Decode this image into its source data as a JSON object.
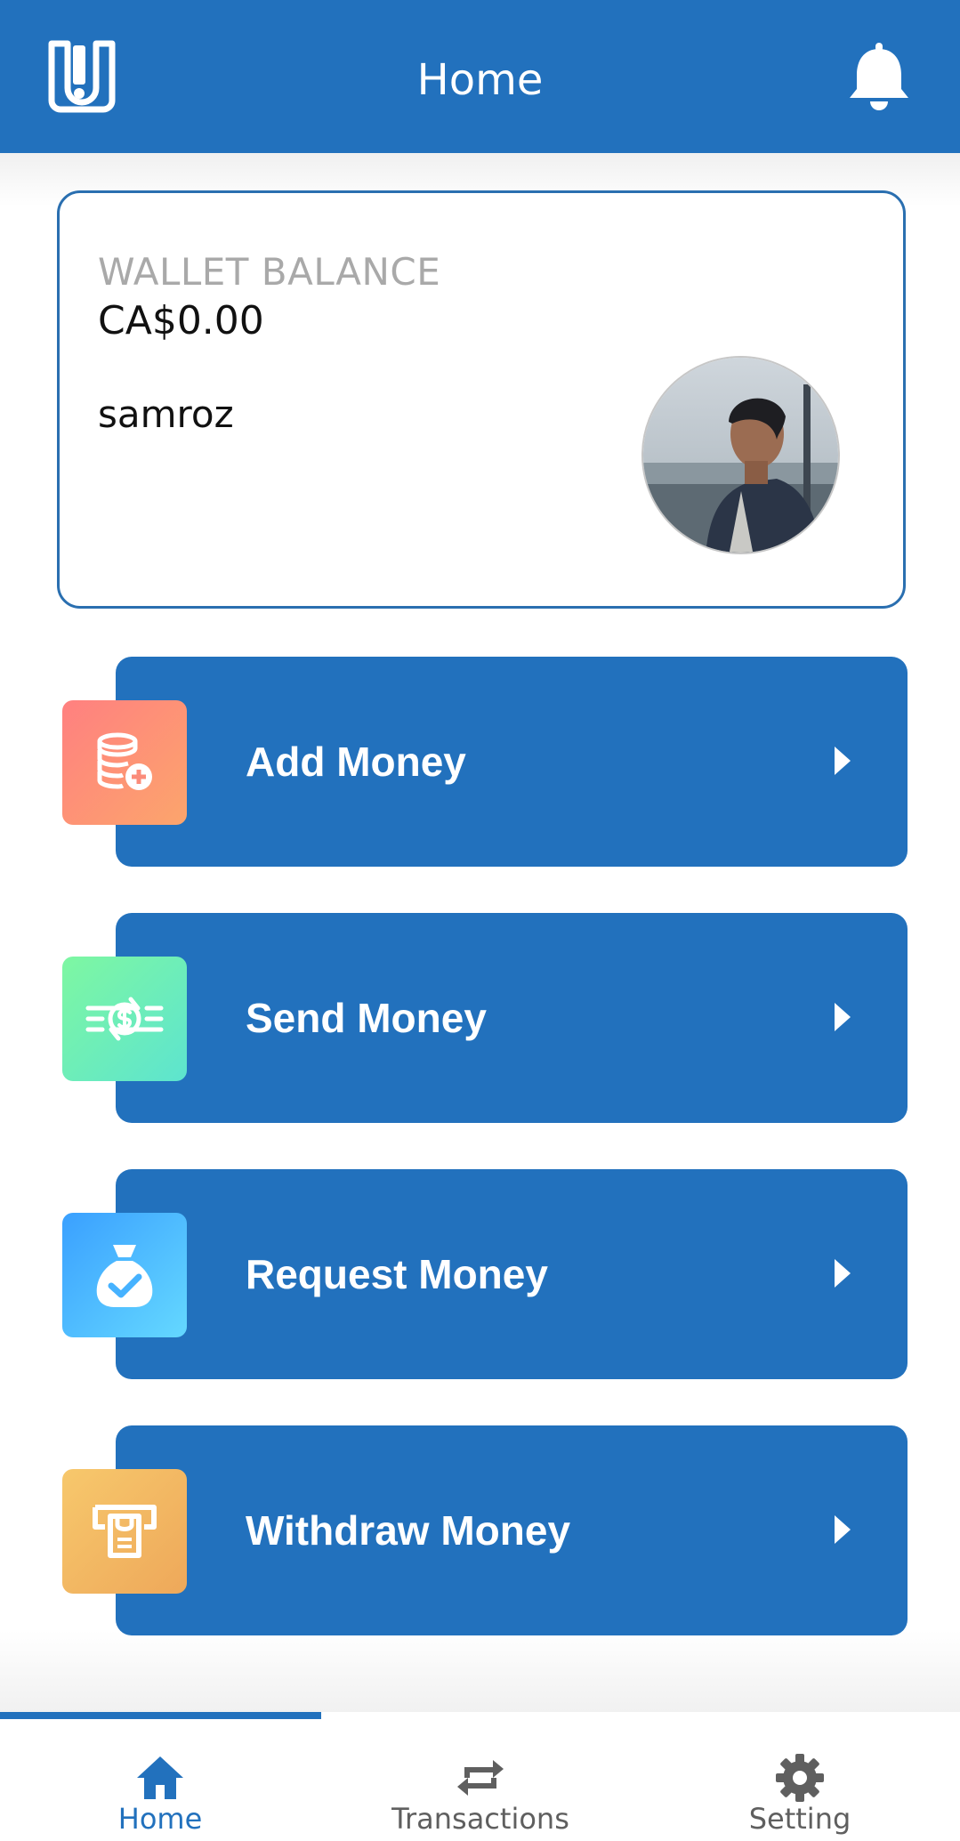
{
  "header": {
    "title": "Home",
    "brand_color": "#2271bd"
  },
  "wallet": {
    "label": "WALLET BALANCE",
    "balance": "CA$0.00",
    "username": "samroz"
  },
  "actions": [
    {
      "label": "Add Money",
      "icon": "add-coins-icon",
      "gradient": [
        "#ff8a80",
        "#fca16f"
      ]
    },
    {
      "label": "Send Money",
      "icon": "send-money-icon",
      "gradient": [
        "#6ff7a0",
        "#5ee6d0"
      ]
    },
    {
      "label": "Request Money",
      "icon": "money-bag-check-icon",
      "gradient": [
        "#42aaff",
        "#62d6ff"
      ]
    },
    {
      "label": "Withdraw Money",
      "icon": "atm-withdraw-icon",
      "gradient": [
        "#f6c46a",
        "#f0a95c"
      ]
    }
  ],
  "bottom_nav": {
    "items": [
      {
        "label": "Home",
        "icon": "home-icon",
        "active": true
      },
      {
        "label": "Transactions",
        "icon": "swap-arrows-icon",
        "active": false
      },
      {
        "label": "Setting",
        "icon": "gear-icon",
        "active": false
      }
    ]
  }
}
